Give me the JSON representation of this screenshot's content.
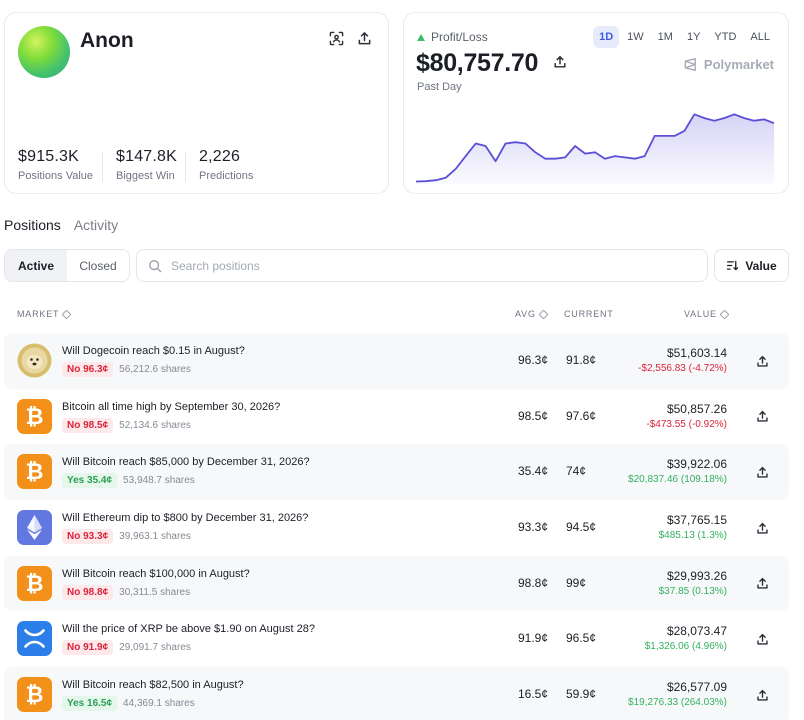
{
  "profile": {
    "username": "Anon",
    "stats": [
      {
        "value": "$915.3K",
        "label": "Positions Value"
      },
      {
        "value": "$147.8K",
        "label": "Biggest Win"
      },
      {
        "value": "2,226",
        "label": "Predictions"
      }
    ],
    "icons": [
      "scan-icon",
      "share-icon"
    ]
  },
  "pnl": {
    "label": "Profit/Loss",
    "value": "$80,757.70",
    "period_label": "Past Day",
    "brand": "Polymarket",
    "ranges": [
      "1D",
      "1W",
      "1M",
      "1Y",
      "YTD",
      "ALL"
    ],
    "active_range": "1D",
    "accent": "#5b4fd6",
    "up_color": "#3dbb6a"
  },
  "chart_data": {
    "type": "area",
    "title": "",
    "xlabel": "",
    "ylabel": "",
    "x": [
      0,
      1,
      2,
      3,
      4,
      5,
      6,
      7,
      8,
      9,
      10,
      11,
      12,
      13,
      14,
      15,
      16,
      17,
      18,
      19,
      20,
      21,
      22,
      23,
      24,
      25,
      26,
      27,
      28,
      29,
      30,
      31,
      32,
      33,
      34,
      35,
      36
    ],
    "series": [
      {
        "values": [
          2,
          2.2,
          3,
          5,
          12,
          22,
          32,
          30,
          18,
          32,
          33,
          32,
          25,
          20,
          20,
          21,
          30,
          24,
          25,
          20,
          22,
          21,
          20,
          22,
          38,
          38,
          38,
          42,
          55,
          52,
          50,
          52,
          55,
          52,
          50,
          51,
          48
        ]
      }
    ],
    "ylim": [
      0,
      60
    ],
    "grid": false
  },
  "tabs": {
    "page": [
      "Positions",
      "Activity"
    ],
    "filter": [
      "Active",
      "Closed"
    ]
  },
  "search": {
    "placeholder": "Search positions"
  },
  "sort": {
    "label": "Value"
  },
  "table": {
    "headers": {
      "market": "MARKET",
      "avg": "AVG",
      "current": "CURRENT",
      "value": "VALUE"
    },
    "rows": [
      {
        "icon": "doge-icon",
        "title": "Will Dogecoin reach $0.15 in August?",
        "side": "No 96.3¢",
        "side_type": "no",
        "shares": "56,212.6 shares",
        "avg": "96.3¢",
        "current": "91.8¢",
        "value": "$51,603.14",
        "change": "-$2,556.83 (-4.72%)",
        "change_type": "neg"
      },
      {
        "icon": "bitcoin-icon",
        "title": "Bitcoin all time high by September 30, 2026?",
        "side": "No 98.5¢",
        "side_type": "no",
        "shares": "52,134.6 shares",
        "avg": "98.5¢",
        "current": "97.6¢",
        "value": "$50,857.26",
        "change": "-$473.55 (-0.92%)",
        "change_type": "neg"
      },
      {
        "icon": "bitcoin-icon",
        "title": "Will Bitcoin reach $85,000 by December 31, 2026?",
        "side": "Yes 35.4¢",
        "side_type": "yes",
        "shares": "53,948.7 shares",
        "avg": "35.4¢",
        "current": "74¢",
        "value": "$39,922.06",
        "change": "$20,837.46 (109.18%)",
        "change_type": "pos"
      },
      {
        "icon": "ethereum-icon",
        "title": "Will Ethereum dip to $800 by December 31, 2026?",
        "side": "No 93.3¢",
        "side_type": "no",
        "shares": "39,963.1 shares",
        "avg": "93.3¢",
        "current": "94.5¢",
        "value": "$37,765.15",
        "change": "$485.13 (1.3%)",
        "change_type": "pos"
      },
      {
        "icon": "bitcoin-icon",
        "title": "Will Bitcoin reach $100,000 in August?",
        "side": "No 98.8¢",
        "side_type": "no",
        "shares": "30,311.5 shares",
        "avg": "98.8¢",
        "current": "99¢",
        "value": "$29,993.26",
        "change": "$37.85 (0.13%)",
        "change_type": "pos"
      },
      {
        "icon": "xrp-icon",
        "title": "Will the price of XRP be above $1.90 on August 28?",
        "side": "No 91.9¢",
        "side_type": "no",
        "shares": "29,091.7 shares",
        "avg": "91.9¢",
        "current": "96.5¢",
        "value": "$28,073.47",
        "change": "$1,326.06 (4.96%)",
        "change_type": "pos"
      },
      {
        "icon": "bitcoin-icon",
        "title": "Will Bitcoin reach $82,500 in August?",
        "side": "Yes 16.5¢",
        "side_type": "yes",
        "shares": "44,369.1 shares",
        "avg": "16.5¢",
        "current": "59.9¢",
        "value": "$26,577.09",
        "change": "$19,276.33 (264.03%)",
        "change_type": "pos"
      }
    ]
  }
}
